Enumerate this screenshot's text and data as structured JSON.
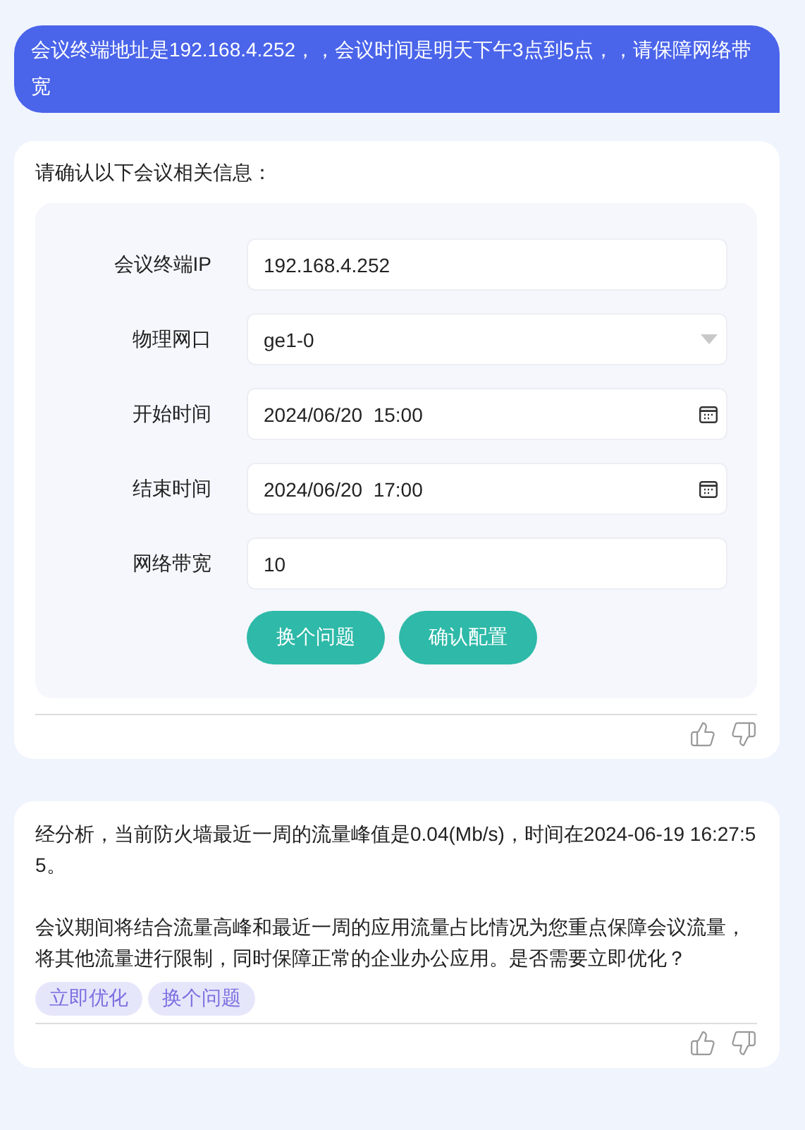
{
  "user_message": "会议终端地址是192.168.4.252，，会议时间是明天下午3点到5点，，请保障网络带宽",
  "config_card": {
    "intro": "请确认以下会议相关信息：",
    "fields": [
      {
        "label": "会议终端IP",
        "value": "192.168.4.252",
        "kind": "text"
      },
      {
        "label": "物理网口",
        "value": "ge1-0",
        "kind": "select"
      },
      {
        "label": "开始时间",
        "value": "2024/06/20  15:00",
        "kind": "datetime"
      },
      {
        "label": "结束时间",
        "value": "2024/06/20  17:00",
        "kind": "datetime"
      },
      {
        "label": "网络带宽",
        "value": "10",
        "kind": "text"
      }
    ],
    "buttons": [
      "换个问题",
      "确认配置"
    ]
  },
  "analysis_card": {
    "paragraphs": [
      "经分析，当前防火墙最近一周的流量峰值是0.04(Mb/s)，时间在2024-06-19 16:27:55。",
      "会议期间将结合流量高峰和最近一周的应用流量占比情况为您重点保障会议流量，将其他流量进行限制，同时保障正常的企业办公应用。是否需要立即优化？"
    ],
    "chips": [
      "立即优化",
      "换个问题"
    ]
  }
}
